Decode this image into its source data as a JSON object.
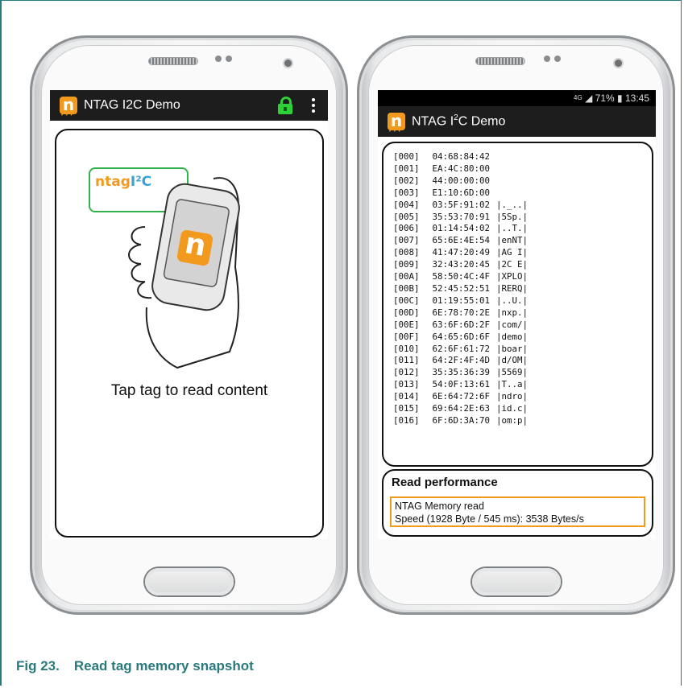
{
  "caption": {
    "fig": "Fig 23.",
    "title": "Read tag memory snapshot"
  },
  "left_phone": {
    "app_title": "NTAG I2C Demo",
    "logo_letter": "n",
    "ntag_logo_text": "ntag",
    "ntag_logo_i2c": "I²C",
    "phone_logo_letter": "n",
    "message": "Tap tag to read content"
  },
  "right_phone": {
    "status": {
      "network": "4G",
      "battery": "71%",
      "time": "13:45"
    },
    "app_title_prefix": "NTAG I",
    "app_title_sup": "2",
    "app_title_suffix": "C Demo",
    "logo_letter": "n",
    "memory_rows": [
      {
        "addr": "[000]",
        "hex": "04:68:84:42",
        "ascii": ""
      },
      {
        "addr": "[001]",
        "hex": "EA:4C:80:00",
        "ascii": ""
      },
      {
        "addr": "[002]",
        "hex": "44:00:00:00",
        "ascii": ""
      },
      {
        "addr": "[003]",
        "hex": "E1:10:6D:00",
        "ascii": ""
      },
      {
        "addr": "[004]",
        "hex": "03:5F:91:02",
        "ascii": "|._..|"
      },
      {
        "addr": "[005]",
        "hex": "35:53:70:91",
        "ascii": "|5Sp.|"
      },
      {
        "addr": "[006]",
        "hex": "01:14:54:02",
        "ascii": "|..T.|"
      },
      {
        "addr": "[007]",
        "hex": "65:6E:4E:54",
        "ascii": "|enNT|"
      },
      {
        "addr": "[008]",
        "hex": "41:47:20:49",
        "ascii": "|AG I|"
      },
      {
        "addr": "[009]",
        "hex": "32:43:20:45",
        "ascii": "|2C E|"
      },
      {
        "addr": "[00A]",
        "hex": "58:50:4C:4F",
        "ascii": "|XPLO|"
      },
      {
        "addr": "[00B]",
        "hex": "52:45:52:51",
        "ascii": "|RERQ|"
      },
      {
        "addr": "[00C]",
        "hex": "01:19:55:01",
        "ascii": "|..U.|"
      },
      {
        "addr": "[00D]",
        "hex": "6E:78:70:2E",
        "ascii": "|nxp.|"
      },
      {
        "addr": "[00E]",
        "hex": "63:6F:6D:2F",
        "ascii": "|com/|"
      },
      {
        "addr": "[00F]",
        "hex": "64:65:6D:6F",
        "ascii": "|demo|"
      },
      {
        "addr": "[010]",
        "hex": "62:6F:61:72",
        "ascii": "|boar|"
      },
      {
        "addr": "[011]",
        "hex": "64:2F:4F:4D",
        "ascii": "|d/OM|"
      },
      {
        "addr": "[012]",
        "hex": "35:35:36:39",
        "ascii": "|5569|"
      },
      {
        "addr": "[013]",
        "hex": "54:0F:13:61",
        "ascii": "|T..a|"
      },
      {
        "addr": "[014]",
        "hex": "6E:64:72:6F",
        "ascii": "|ndro|"
      },
      {
        "addr": "[015]",
        "hex": "69:64:2E:63",
        "ascii": "|id.c|"
      },
      {
        "addr": "[016]",
        "hex": "6F:6D:3A:70",
        "ascii": "|om:p|"
      }
    ],
    "perf_title": "Read performance",
    "perf_line1": "NTAG Memory read",
    "perf_line2": "Speed (1928 Byte / 545 ms): 3538 Bytes/s"
  },
  "colors": {
    "accent": "#f29a1d",
    "lock": "#2fd13a",
    "caption": "#2a7a7c"
  }
}
